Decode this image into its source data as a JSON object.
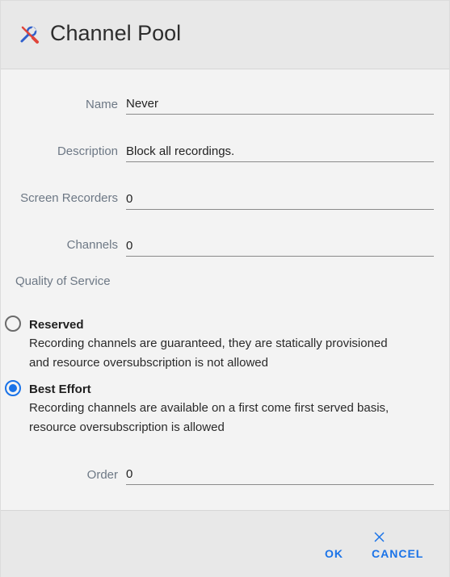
{
  "dialog": {
    "title": "Channel Pool",
    "title_icon": "tools-icon"
  },
  "fields": {
    "name": {
      "label": "Name",
      "value": "Never"
    },
    "description": {
      "label": "Description",
      "value": "Block all recordings."
    },
    "screen_recorders": {
      "label": "Screen Recorders",
      "value": "0"
    },
    "channels": {
      "label": "Channels",
      "value": "0"
    },
    "order": {
      "label": "Order",
      "value": "0"
    }
  },
  "qos": {
    "label": "Quality of Service",
    "selected": "best_effort",
    "options": [
      {
        "id": "reserved",
        "title": "Reserved",
        "desc_line1": "Recording channels are guaranteed, they are statically provisioned",
        "desc_line2": "and resource oversubscription is not allowed",
        "checked": false
      },
      {
        "id": "best_effort",
        "title": "Best Effort",
        "desc_line1": "Recording channels are available on a first come first served basis,",
        "desc_line2": "resource oversubscription is allowed",
        "checked": true
      }
    ]
  },
  "footer": {
    "ok_label": "OK",
    "cancel_label": "CANCEL",
    "cancel_icon": "close-icon"
  },
  "colors": {
    "accent": "#1a73e8",
    "title_icon_red": "#e0453a",
    "title_icon_blue": "#2f5fcc",
    "label": "#6d7885"
  }
}
